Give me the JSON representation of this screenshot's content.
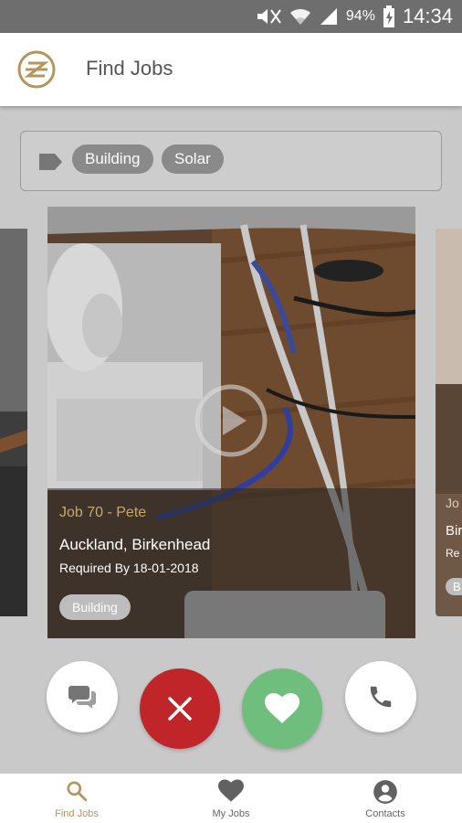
{
  "status_bar": {
    "battery": "94%",
    "time": "14:34"
  },
  "app_bar": {
    "title": "Find Jobs"
  },
  "filters": {
    "chips": [
      "Building",
      "Solar"
    ]
  },
  "side_cards": {
    "right_title": "Jo",
    "right_location": "Bir",
    "right_required": "Re",
    "right_chip": "B"
  },
  "job_card": {
    "title": "Job 70 - Pete",
    "location": "Auckland, Birkenhead",
    "required_by": "Required By 18-01-2018",
    "category": "Building"
  },
  "actions": {
    "chat": "chat-icon",
    "reject": "close-icon",
    "like": "heart-icon",
    "call": "phone-icon"
  },
  "colors": {
    "accent": "#b4955b",
    "reject": "#c0252a",
    "like": "#6fbe7e"
  },
  "bottom_nav": {
    "items": [
      {
        "label": "Find Jobs",
        "icon": "search-icon"
      },
      {
        "label": "My Jobs",
        "icon": "heart-icon"
      },
      {
        "label": "Contacts",
        "icon": "account-icon"
      }
    ]
  }
}
